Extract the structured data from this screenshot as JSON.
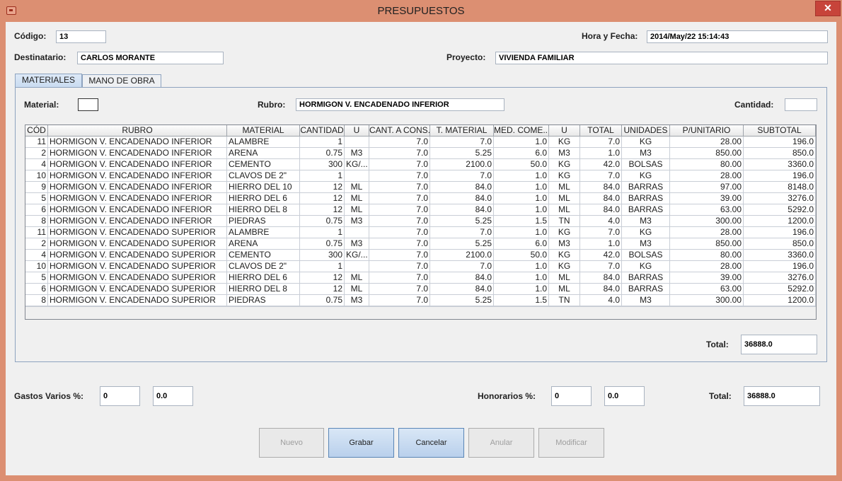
{
  "window": {
    "title": "PRESUPUESTOS",
    "close_glyph": "✕"
  },
  "header": {
    "codigo_label": "Código:",
    "codigo_value": "13",
    "fecha_label": "Hora y Fecha:",
    "fecha_value": "2014/May/22 15:14:43",
    "destinatario_label": "Destinatario:",
    "destinatario_value": "CARLOS MORANTE",
    "proyecto_label": "Proyecto:",
    "proyecto_value": "VIVIENDA FAMILIAR"
  },
  "tabs": [
    {
      "label": "MATERIALES"
    },
    {
      "label": "MANO DE OBRA"
    }
  ],
  "filters": {
    "material_label": "Material:",
    "material_value": "",
    "rubro_label": "Rubro:",
    "rubro_value": "HORMIGON V. ENCADENADO INFERIOR",
    "cantidad_label": "Cantidad:",
    "cantidad_value": ""
  },
  "table": {
    "columns": [
      "CÓD",
      "RUBRO",
      "MATERIAL",
      "CANTIDAD",
      "U",
      "CANT. A CONS.",
      "T. MATERIAL",
      "MED. COME...",
      "U",
      "TOTAL",
      "UNIDADES",
      "P/UNITARIO",
      "SUBTOTAL"
    ],
    "rows": [
      [
        "11",
        "HORMIGON V. ENCADENADO INFERIOR",
        "ALAMBRE",
        "1",
        "",
        "7.0",
        "7.0",
        "1.0",
        "KG",
        "7.0",
        "KG",
        "28.00",
        "196.0"
      ],
      [
        "2",
        "HORMIGON V. ENCADENADO INFERIOR",
        "ARENA",
        "0.75",
        "M3",
        "7.0",
        "5.25",
        "6.0",
        "M3",
        "1.0",
        "M3",
        "850.00",
        "850.0"
      ],
      [
        "4",
        "HORMIGON V. ENCADENADO INFERIOR",
        "CEMENTO",
        "300",
        "KG/...",
        "7.0",
        "2100.0",
        "50.0",
        "KG",
        "42.0",
        "BOLSAS",
        "80.00",
        "3360.0"
      ],
      [
        "10",
        "HORMIGON V. ENCADENADO INFERIOR",
        "CLAVOS DE 2\"",
        "1",
        "",
        "7.0",
        "7.0",
        "1.0",
        "KG",
        "7.0",
        "KG",
        "28.00",
        "196.0"
      ],
      [
        "9",
        "HORMIGON V. ENCADENADO INFERIOR",
        "HIERRO DEL 10",
        "12",
        "ML",
        "7.0",
        "84.0",
        "1.0",
        "ML",
        "84.0",
        "BARRAS",
        "97.00",
        "8148.0"
      ],
      [
        "5",
        "HORMIGON V. ENCADENADO INFERIOR",
        "HIERRO DEL 6",
        "12",
        "ML",
        "7.0",
        "84.0",
        "1.0",
        "ML",
        "84.0",
        "BARRAS",
        "39.00",
        "3276.0"
      ],
      [
        "6",
        "HORMIGON V. ENCADENADO INFERIOR",
        "HIERRO DEL 8",
        "12",
        "ML",
        "7.0",
        "84.0",
        "1.0",
        "ML",
        "84.0",
        "BARRAS",
        "63.00",
        "5292.0"
      ],
      [
        "8",
        "HORMIGON V. ENCADENADO INFERIOR",
        "PIEDRAS",
        "0.75",
        "M3",
        "7.0",
        "5.25",
        "1.5",
        "TN",
        "4.0",
        "M3",
        "300.00",
        "1200.0"
      ],
      [
        "11",
        "HORMIGON V. ENCADENADO SUPERIOR",
        "ALAMBRE",
        "1",
        "",
        "7.0",
        "7.0",
        "1.0",
        "KG",
        "7.0",
        "KG",
        "28.00",
        "196.0"
      ],
      [
        "2",
        "HORMIGON V. ENCADENADO SUPERIOR",
        "ARENA",
        "0.75",
        "M3",
        "7.0",
        "5.25",
        "6.0",
        "M3",
        "1.0",
        "M3",
        "850.00",
        "850.0"
      ],
      [
        "4",
        "HORMIGON V. ENCADENADO SUPERIOR",
        "CEMENTO",
        "300",
        "KG/...",
        "7.0",
        "2100.0",
        "50.0",
        "KG",
        "42.0",
        "BOLSAS",
        "80.00",
        "3360.0"
      ],
      [
        "10",
        "HORMIGON V. ENCADENADO SUPERIOR",
        "CLAVOS DE 2\"",
        "1",
        "",
        "7.0",
        "7.0",
        "1.0",
        "KG",
        "7.0",
        "KG",
        "28.00",
        "196.0"
      ],
      [
        "5",
        "HORMIGON V. ENCADENADO SUPERIOR",
        "HIERRO DEL 6",
        "12",
        "ML",
        "7.0",
        "84.0",
        "1.0",
        "ML",
        "84.0",
        "BARRAS",
        "39.00",
        "3276.0"
      ],
      [
        "6",
        "HORMIGON V. ENCADENADO SUPERIOR",
        "HIERRO DEL 8",
        "12",
        "ML",
        "7.0",
        "84.0",
        "1.0",
        "ML",
        "84.0",
        "BARRAS",
        "63.00",
        "5292.0"
      ],
      [
        "8",
        "HORMIGON V. ENCADENADO SUPERIOR",
        "PIEDRAS",
        "0.75",
        "M3",
        "7.0",
        "5.25",
        "1.5",
        "TN",
        "4.0",
        "M3",
        "300.00",
        "1200.0"
      ]
    ]
  },
  "panel_total": {
    "label": "Total:",
    "value": "36888.0"
  },
  "footer": {
    "gastos_label": "Gastos Varios %:",
    "gastos_pct": "0",
    "gastos_value": "0.0",
    "honorarios_label": "Honorarios %:",
    "honorarios_pct": "0",
    "honorarios_value": "0.0",
    "total_label": "Total:",
    "total_value": "36888.0"
  },
  "buttons": {
    "nuevo": "Nuevo",
    "grabar": "Grabar",
    "cancelar": "Cancelar",
    "anular": "Anular",
    "modificar": "Modificar"
  }
}
